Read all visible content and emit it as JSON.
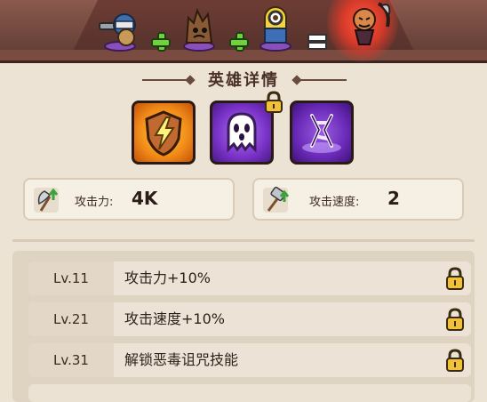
{
  "colors": {
    "background": "#ece3d5",
    "header_brown": "#53302b",
    "plus_green": "#6fd23a",
    "lock_gold": "#f2c13a"
  },
  "formula": {
    "heroes": [
      "gunner-hero-icon",
      "tree-stump-hero-icon",
      "minion-hero-icon"
    ],
    "operators": [
      "+",
      "+",
      "="
    ],
    "result": "scythe-pumpkin-hero-icon"
  },
  "section_title": "英雄详情",
  "skills": [
    {
      "icon": "lightning-shield-icon",
      "locked": false
    },
    {
      "icon": "ghost-icon",
      "locked": true
    },
    {
      "icon": "curse-rune-icon",
      "locked": false
    }
  ],
  "stats": [
    {
      "icon": "axe-upgrade-icon",
      "label": "攻击力:",
      "value": "4K"
    },
    {
      "icon": "hammer-upgrade-icon",
      "label": "攻击速度:",
      "value": "2"
    }
  ],
  "upgrades": [
    {
      "level": "Lv.11",
      "text": "攻击力+10%",
      "locked": true
    },
    {
      "level": "Lv.21",
      "text": "攻击速度+10%",
      "locked": true
    },
    {
      "level": "Lv.31",
      "text": "解锁恶毒诅咒技能",
      "locked": true
    }
  ]
}
